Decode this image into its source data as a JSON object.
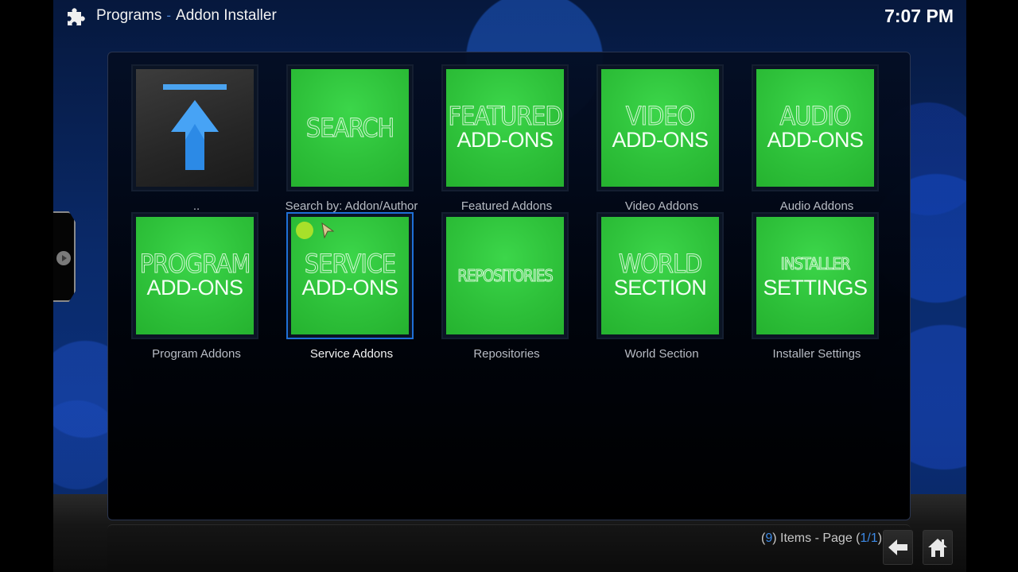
{
  "header": {
    "section": "Programs",
    "separator": "-",
    "title": "Addon Installer",
    "icon": "puzzle-piece-icon",
    "clock": "7:07 PM"
  },
  "grid": {
    "focused_index": 6,
    "items": [
      {
        "id": "parent",
        "label": "..",
        "tile_lines": [],
        "icon": "parent-folder-arrow-icon"
      },
      {
        "id": "search",
        "label": "Search by: Addon/Author",
        "tile_lines": [
          "SEARCH"
        ]
      },
      {
        "id": "featured",
        "label": "Featured Addons",
        "tile_lines": [
          "FEATURED",
          "ADD-ONS"
        ]
      },
      {
        "id": "video",
        "label": "Video Addons",
        "tile_lines": [
          "VIDEO",
          "ADD-ONS"
        ]
      },
      {
        "id": "audio",
        "label": "Audio Addons",
        "tile_lines": [
          "AUDIO",
          "ADD-ONS"
        ]
      },
      {
        "id": "program",
        "label": "Program Addons",
        "tile_lines": [
          "PROGRAM",
          "ADD-ONS"
        ]
      },
      {
        "id": "service",
        "label": "Service Addons",
        "tile_lines": [
          "SERVICE",
          "ADD-ONS"
        ]
      },
      {
        "id": "repositories",
        "label": "Repositories",
        "tile_lines": [
          "REPOSITORIES"
        ]
      },
      {
        "id": "world",
        "label": "World Section",
        "tile_lines": [
          "WORLD",
          "SECTION"
        ]
      },
      {
        "id": "installer-settings",
        "label": "Installer Settings",
        "tile_lines": [
          "INSTALLER",
          "SETTINGS"
        ]
      }
    ]
  },
  "footer": {
    "count_open": "(",
    "count": "9",
    "count_text": ") Items - Page (",
    "page": "1/1",
    "page_close": ")",
    "back_icon": "back-arrow-icon",
    "home_icon": "home-icon"
  },
  "colors": {
    "tile_green": "#2ec13a",
    "focus_blue": "#1f6fd6",
    "highlight_blue": "#3d8ae6",
    "cursor_dot": "#a8e02a"
  }
}
